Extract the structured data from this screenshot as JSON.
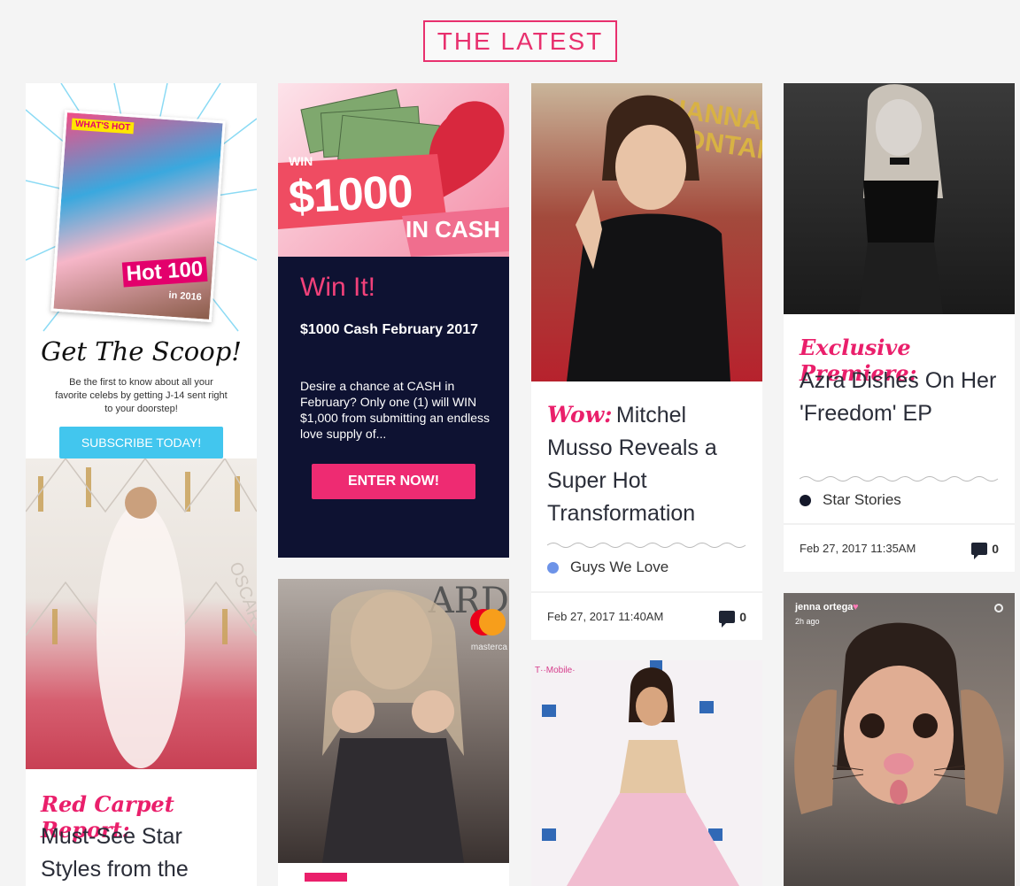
{
  "section": {
    "title": "THE LATEST"
  },
  "magazine": {
    "banner": "WHAT'S HOT",
    "cover_text": "Hot 100",
    "cover_year": "in 2016",
    "heading": "Get The Scoop!",
    "body": "Be the first to know about all your favorite celebs by getting J-14 sent right to your doorstep!",
    "button": "SUBSCRIBE TODAY!"
  },
  "promo": {
    "win_tag": "WIN",
    "amount": "$1000",
    "cash_tag": "IN CASH",
    "heading": "Win It!",
    "subheading": "$1000 Cash February 2017",
    "body": "Desire a chance at CASH in February? Only one (1) will WIN $1,000 from submitting an endless love supply of...",
    "button": "ENTER NOW!"
  },
  "articles": [
    {
      "kicker": "Wow:",
      "title": "Mitchel Musso Reveals a Super Hot Transformation",
      "category": "Guys We Love",
      "category_color": "#6d93e8",
      "date": "Feb 27, 2017 11:40AM",
      "comments": "0",
      "bg_text": "HANNAH MONTANA"
    },
    {
      "kicker": "Exclusive Premiere:",
      "title": "Azra Dishes On Her 'Freedom' EP",
      "category": "Star Stories",
      "category_color": "#14182a",
      "date": "Feb 27, 2017 11:35AM",
      "comments": "0"
    },
    {
      "kicker": "Red Carpet Report:",
      "title": "Must-See Star Styles from the",
      "bg_text": "OSCARS"
    },
    {
      "bg_text": "ARD",
      "sponsor": "masterca"
    },
    {
      "bg_text": "T··Mobile·"
    },
    {
      "username": "jenna ortega",
      "time": "2h ago"
    }
  ],
  "colors": {
    "accent": "#e8306e",
    "navy": "#0e1232",
    "text": "#2a2d38",
    "subscribe": "#42c6ee"
  }
}
